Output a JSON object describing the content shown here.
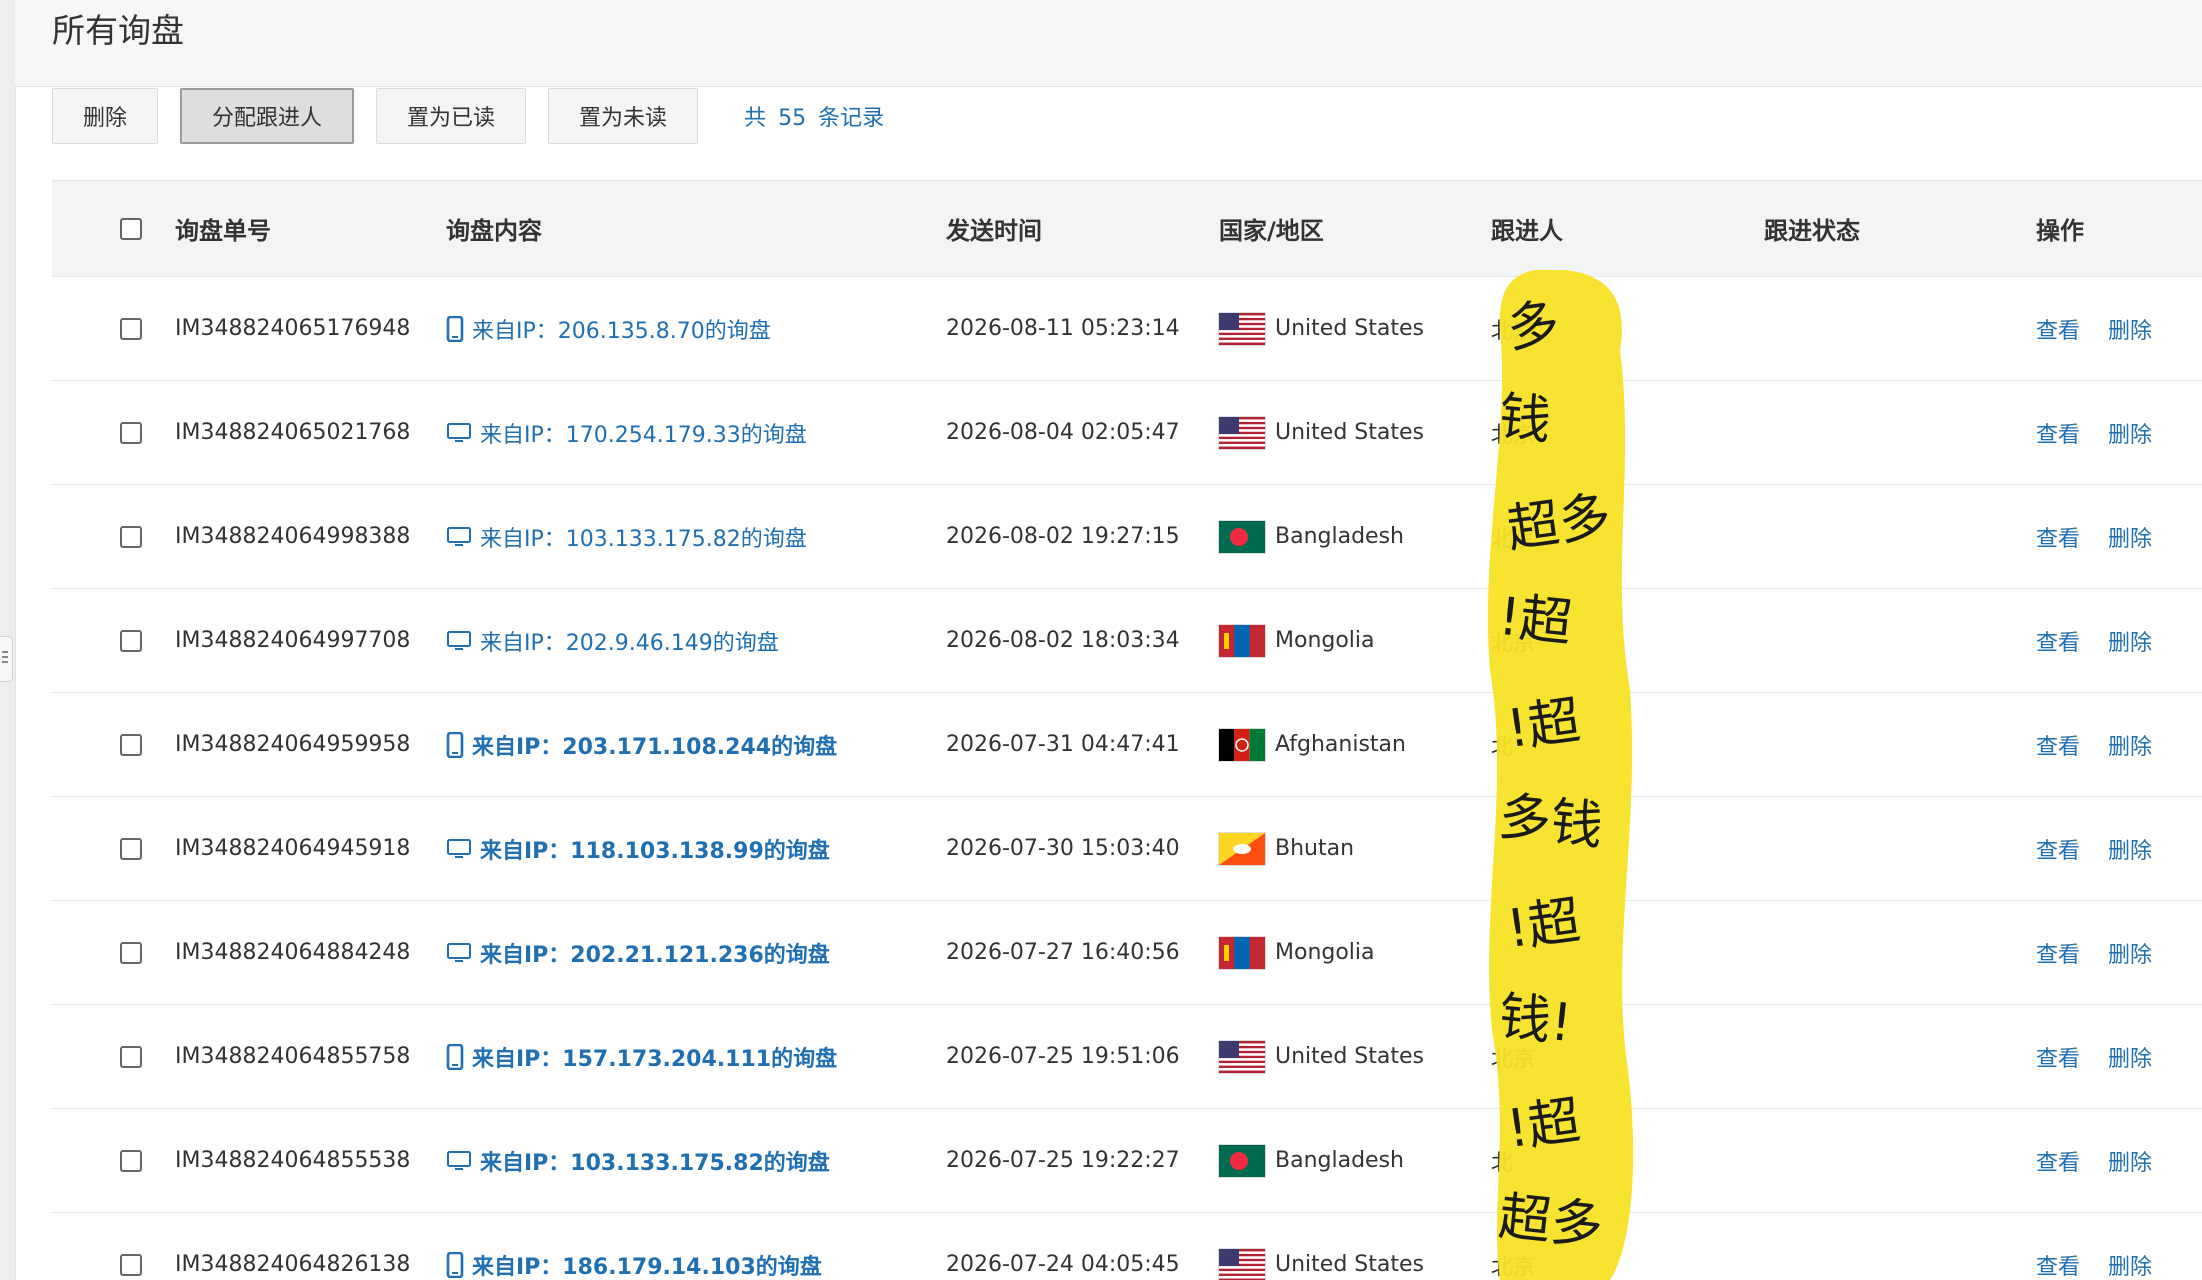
{
  "page_title": "所有询盘",
  "toolbar": {
    "delete_label": "删除",
    "assign_label": "分配跟进人",
    "mark_read_label": "置为已读",
    "mark_unread_label": "置为未读",
    "record_prefix": "共",
    "record_count": "55",
    "record_suffix": "条记录"
  },
  "table": {
    "headers": {
      "id": "询盘单号",
      "content": "询盘内容",
      "time": "发送时间",
      "country": "国家/地区",
      "follower": "跟进人",
      "status": "跟进状态",
      "ops": "操作"
    },
    "view_label": "查看",
    "delete_label": "删除",
    "follower_fragments": [
      "北京",
      "北京",
      "北京",
      "北京",
      "北",
      "",
      "",
      "北京",
      "北",
      "北京"
    ],
    "rows": [
      {
        "id": "IM348824065176948",
        "content": "来自IP：206.135.8.70的询盘",
        "device": "mobile",
        "bold": false,
        "time": "2026-08-11 05:23:14",
        "country": "United States",
        "flag": "us"
      },
      {
        "id": "IM348824065021768",
        "content": "来自IP：170.254.179.33的询盘",
        "device": "desktop",
        "bold": false,
        "time": "2026-08-04 02:05:47",
        "country": "United States",
        "flag": "us"
      },
      {
        "id": "IM348824064998388",
        "content": "来自IP：103.133.175.82的询盘",
        "device": "desktop",
        "bold": false,
        "time": "2026-08-02 19:27:15",
        "country": "Bangladesh",
        "flag": "bd"
      },
      {
        "id": "IM348824064997708",
        "content": "来自IP：202.9.46.149的询盘",
        "device": "desktop",
        "bold": false,
        "time": "2026-08-02 18:03:34",
        "country": "Mongolia",
        "flag": "mn"
      },
      {
        "id": "IM348824064959958",
        "content": "来自IP：203.171.108.244的询盘",
        "device": "mobile",
        "bold": true,
        "time": "2026-07-31 04:47:41",
        "country": "Afghanistan",
        "flag": "af"
      },
      {
        "id": "IM348824064945918",
        "content": "来自IP：118.103.138.99的询盘",
        "device": "desktop",
        "bold": true,
        "time": "2026-07-30 15:03:40",
        "country": "Bhutan",
        "flag": "bt"
      },
      {
        "id": "IM348824064884248",
        "content": "来自IP：202.21.121.236的询盘",
        "device": "desktop",
        "bold": true,
        "time": "2026-07-27 16:40:56",
        "country": "Mongolia",
        "flag": "mn"
      },
      {
        "id": "IM348824064855758",
        "content": "来自IP：157.173.204.111的询盘",
        "device": "mobile",
        "bold": true,
        "time": "2026-07-25 19:51:06",
        "country": "United States",
        "flag": "us"
      },
      {
        "id": "IM348824064855538",
        "content": "来自IP：103.133.175.82的询盘",
        "device": "desktop",
        "bold": true,
        "time": "2026-07-25 19:22:27",
        "country": "Bangladesh",
        "flag": "bd"
      },
      {
        "id": "IM348824064826138",
        "content": "来自IP：186.179.14.103的询盘",
        "device": "mobile",
        "bold": true,
        "time": "2026-07-24 04:05:45",
        "country": "United States",
        "flag": "us"
      }
    ]
  },
  "scribble_lines": [
    "多",
    "钱",
    "超多",
    "!超",
    "!超",
    "多钱",
    "!超",
    "钱!",
    "!超",
    "超多"
  ],
  "colors": {
    "link": "#1f6fb2",
    "highlight": "#f7e225"
  }
}
